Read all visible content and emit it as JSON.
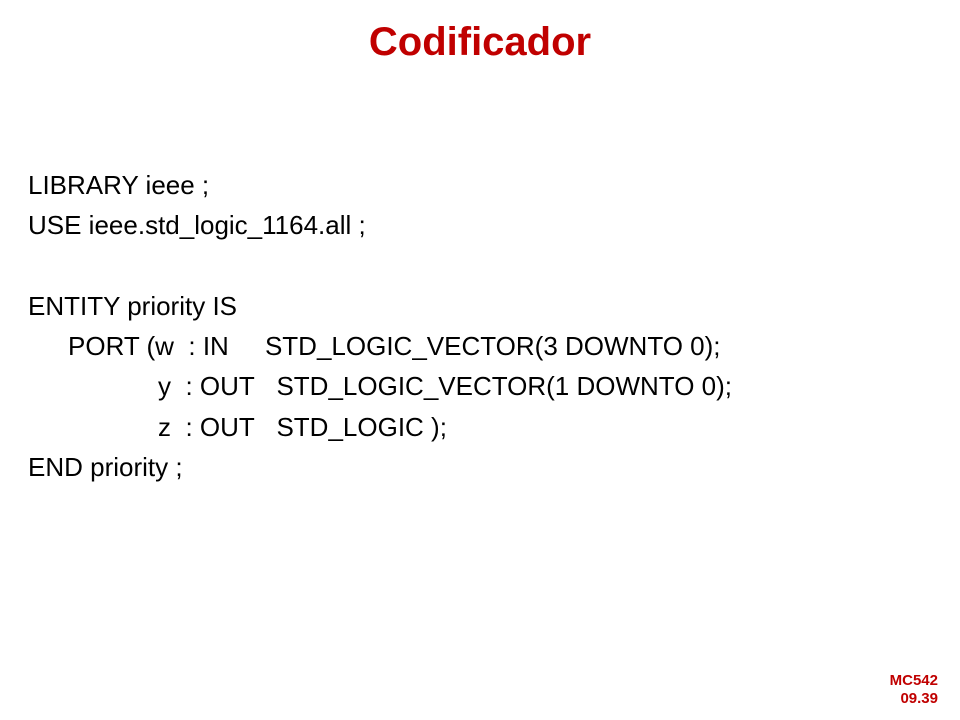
{
  "title": "Codificador",
  "code": {
    "lines": [
      {
        "text": "LIBRARY ieee ;",
        "indent": 0
      },
      {
        "text": "USE ieee.std_logic_1164.all ;",
        "indent": 0
      },
      {
        "text": "",
        "indent": 0
      },
      {
        "text": "ENTITY priority IS",
        "indent": 0
      },
      {
        "text": "PORT (w  : IN     STD_LOGIC_VECTOR(3 DOWNTO 0);",
        "indent": 1
      },
      {
        "text": "y  : OUT   STD_LOGIC_VECTOR(1 DOWNTO 0);",
        "indent": 2
      },
      {
        "text": "z  : OUT   STD_LOGIC );",
        "indent": 2
      },
      {
        "text": "END priority ;",
        "indent": 0
      }
    ]
  },
  "footer": {
    "course": "MC542",
    "page": "09.39"
  }
}
